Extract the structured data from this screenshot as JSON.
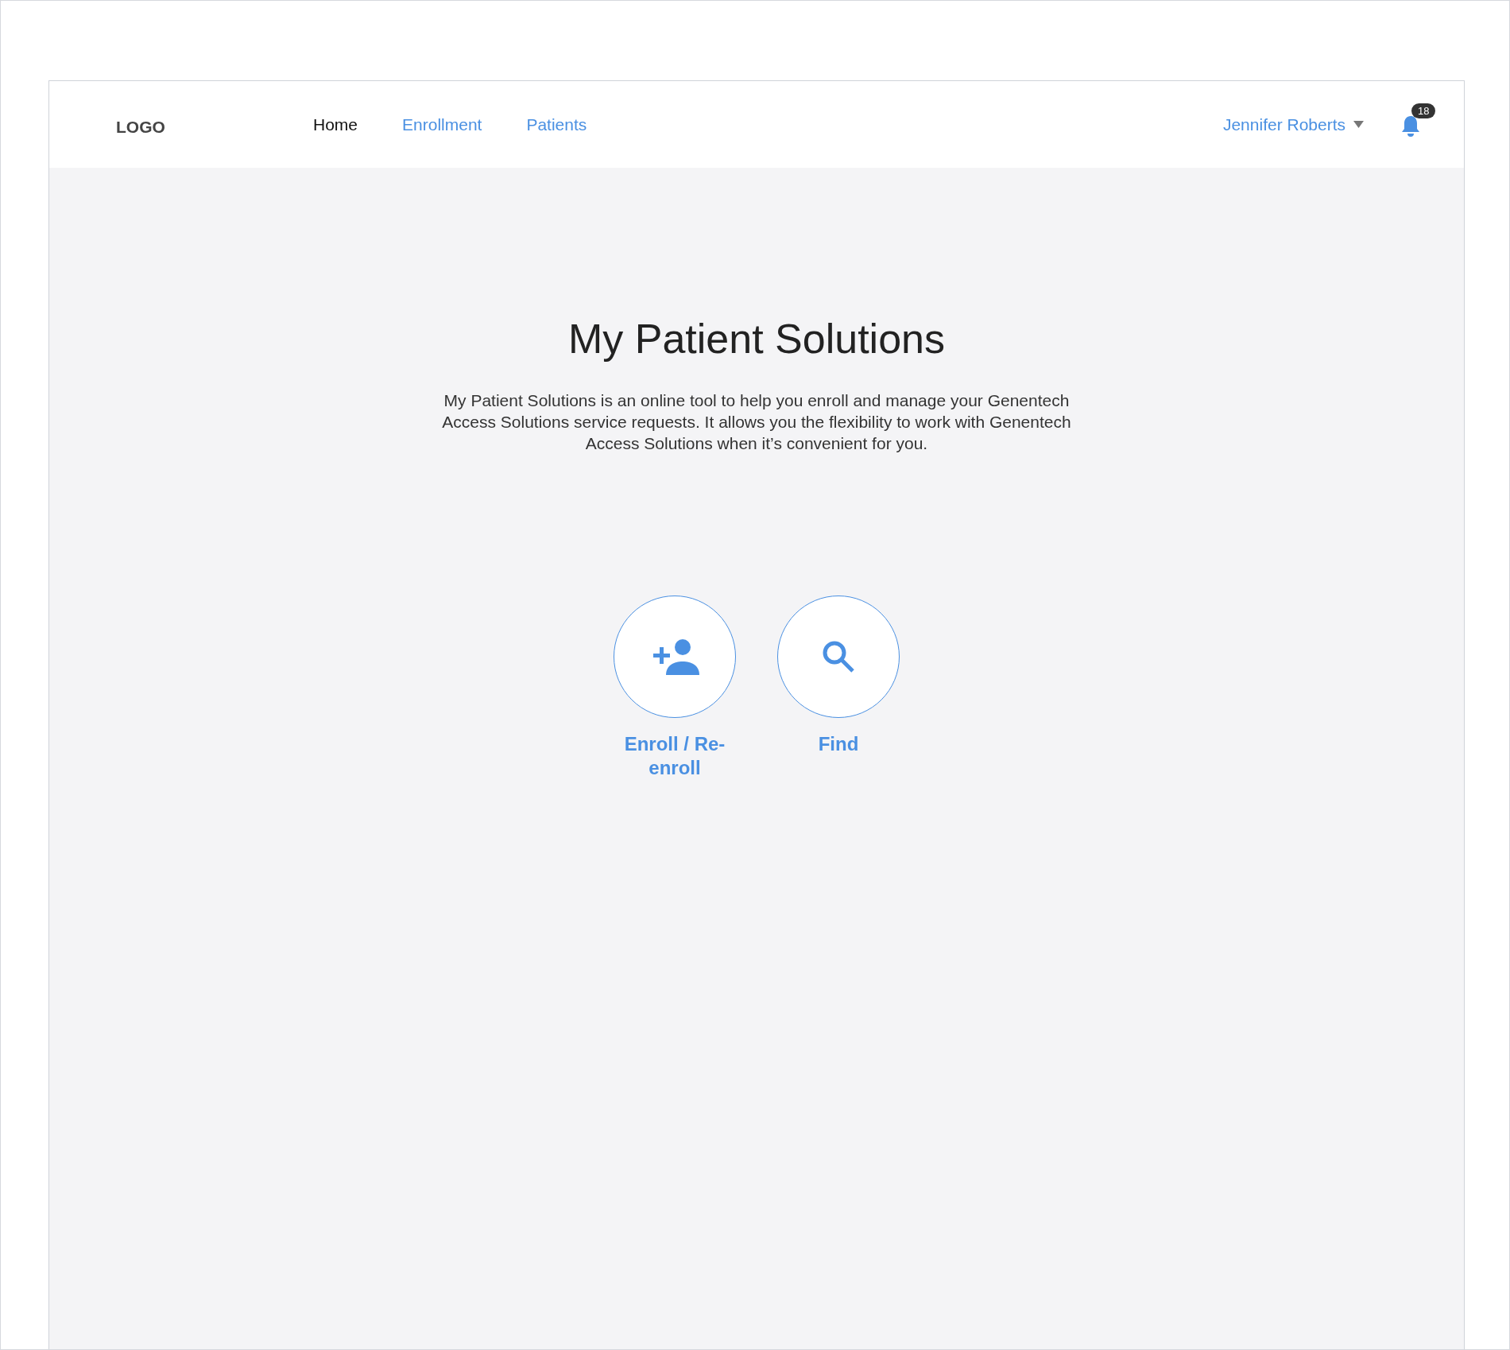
{
  "header": {
    "logo": "LOGO",
    "nav": [
      {
        "label": "Home",
        "selected": true
      },
      {
        "label": "Enrollment",
        "selected": false
      },
      {
        "label": "Patients",
        "selected": false
      }
    ],
    "user": {
      "name": "Jennifer Roberts"
    },
    "notifications": {
      "count": "18"
    }
  },
  "main": {
    "title": "My Patient Solutions",
    "description": "My Patient Solutions is an online tool to help you enroll and manage your Genentech Access Solutions service requests. It allows you the flexibility to work with Genentech Access Solutions when it’s convenient for you.",
    "actions": [
      {
        "kind": "add-person",
        "label": "Enroll / Re-enroll"
      },
      {
        "kind": "search",
        "label": "Find"
      }
    ]
  }
}
